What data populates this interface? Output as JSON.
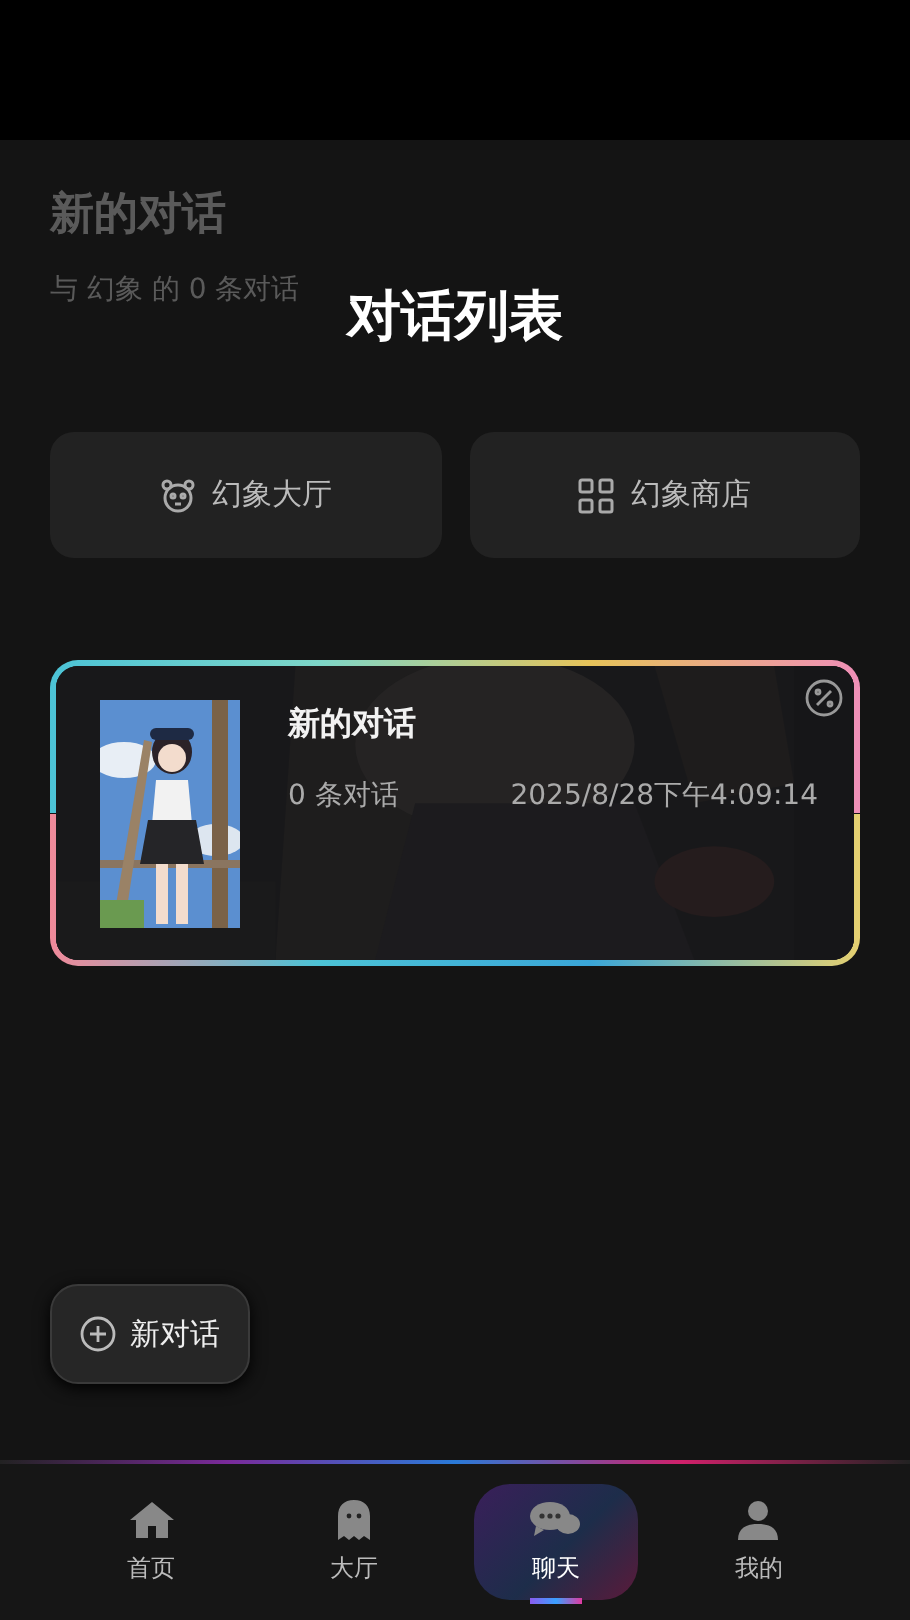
{
  "backdrop": {
    "title": "新的对话",
    "subtitle": "与 幻象 的 0 条对话"
  },
  "dialog": {
    "title": "对话列表"
  },
  "shortcuts": [
    {
      "kind": "panda",
      "label": "幻象大厅"
    },
    {
      "kind": "grid",
      "label": "幻象商店"
    }
  ],
  "conversations": [
    {
      "title": "新的对话",
      "count": "0 条对话",
      "time": "2025/8/28下午4:09:14",
      "selected": true
    }
  ],
  "new_button": {
    "label": "新对话"
  },
  "nav": [
    {
      "kind": "home",
      "label": "首页",
      "selected": false
    },
    {
      "kind": "ghost",
      "label": "大厅",
      "selected": false
    },
    {
      "kind": "chat",
      "label": "聊天",
      "selected": true
    },
    {
      "kind": "user",
      "label": "我的",
      "selected": false
    }
  ]
}
